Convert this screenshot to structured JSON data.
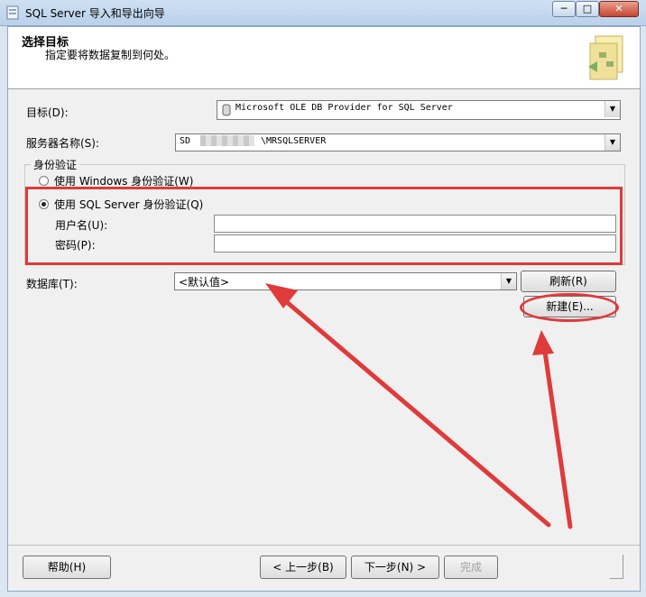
{
  "window": {
    "title": "SQL Server 导入和导出向导",
    "minimize": "─",
    "maximize": "□",
    "close": "✕"
  },
  "header": {
    "title": "选择目标",
    "subtitle": "指定要将数据复制到何处。"
  },
  "form": {
    "destination_label": "目标(D):",
    "destination_value": "Microsoft OLE DB Provider for SQL Server",
    "server_label": "服务器名称(S):",
    "server_prefix": "SD",
    "server_suffix": "\\MRSQLSERVER",
    "auth_group_label": "身份验证",
    "auth_windows": "使用 Windows 身份验证(W)",
    "auth_sql": "使用 SQL Server 身份验证(Q)",
    "username_label": "用户名(U):",
    "password_label": "密码(P):",
    "username_value": "",
    "password_value": "",
    "database_label": "数据库(T):",
    "database_value": "<默认值>",
    "refresh_button": "刷新(R)",
    "new_button": "新建(E)..."
  },
  "footer": {
    "help": "帮助(H)",
    "back": "< 上一步(B)",
    "next": "下一步(N) >",
    "finish": "完成"
  },
  "colors": {
    "annotation": "#e03a3a"
  },
  "icons": {
    "app": "wizard-app-icon",
    "logo": "wizard-logo-icon"
  }
}
